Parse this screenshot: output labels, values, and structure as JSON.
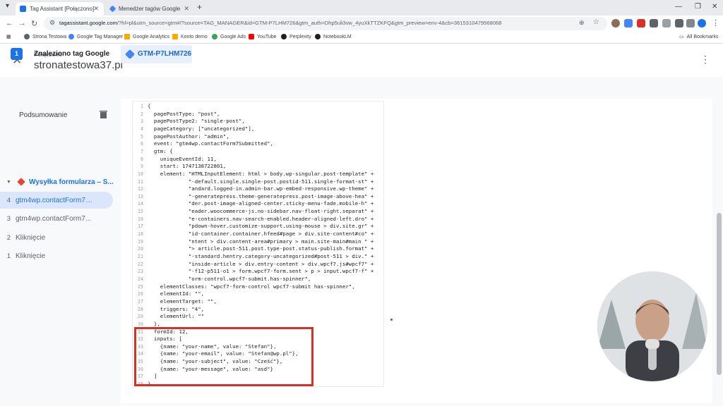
{
  "browser": {
    "tabs": [
      {
        "title": "Tag Assistant [Połączono]",
        "active": true
      },
      {
        "title": "Menedżer tagów Google",
        "active": false
      }
    ],
    "new_tab_glyph": "+",
    "url_host": "tagassistant.google.com",
    "url_rest": "/?hl=pl&utm_source=gtm#/?source=TAG_MANAGER&id=GTM-P7LHM726&gtm_auth=Dhp5uli3vw_4yuXkTTZKFQ&gtm_preview=env-4&cb=3615310479568068",
    "bookmarks": [
      {
        "label": "Strona Testowa",
        "color": "#5f6368"
      },
      {
        "label": "Google Tag Manager",
        "color": "#4285f4"
      },
      {
        "label": "Google Analytics",
        "color": "#f9ab00"
      },
      {
        "label": "Konto demo",
        "color": "#f9ab00"
      },
      {
        "label": "Google Ads",
        "color": "#34a853"
      },
      {
        "label": "YouTube",
        "color": "#ff0000"
      },
      {
        "label": "Perplexity",
        "color": "#202124"
      },
      {
        "label": "NotebookLM",
        "color": "#202124"
      }
    ],
    "all_bookmarks": "All Bookmarks"
  },
  "header": {
    "status": "Połączono",
    "site": "stronatestowa37.pl"
  },
  "subheader": {
    "step_number": "1",
    "found_label": "Znaleziono tag Google",
    "container_id": "GTM-P7LHM726"
  },
  "sidebar": {
    "summary_label": "Podsumowanie",
    "group_label": "Wysyłka formularza – S...",
    "items": [
      {
        "num": "4",
        "label": "gtm4wp.contactForm7S...",
        "selected": true
      },
      {
        "num": "3",
        "label": "gtm4wp.contactForm7...",
        "selected": false
      },
      {
        "num": "2",
        "label": "Kliknięcie",
        "selected": false
      },
      {
        "num": "1",
        "label": "Kliknięcie",
        "selected": false
      }
    ]
  },
  "code_lines": [
    {
      "n": "1",
      "t": "{"
    },
    {
      "n": "2",
      "t": "  pagePostType: \"post\","
    },
    {
      "n": "3",
      "t": "  pagePostType2: \"single-post\","
    },
    {
      "n": "4",
      "t": "  pageCategory: [\"uncategorized\"],"
    },
    {
      "n": "5",
      "t": "  pagePostAuthor: \"admin\","
    },
    {
      "n": "6",
      "t": "  event: \"gtm4wp.contactForm7Submitted\","
    },
    {
      "n": "7",
      "t": "  gtm: {"
    },
    {
      "n": "8",
      "t": "    uniqueEventId: 11,"
    },
    {
      "n": "9",
      "t": "    start: 1747138722801,"
    },
    {
      "n": "10",
      "t": "    element: \"HTMLInputElement: html > body.wp-singular.post-template\" +"
    },
    {
      "n": "11",
      "t": "             \"-default.single.single-post.postid-511.single-format-st\" +"
    },
    {
      "n": "12",
      "t": "             \"andard.logged-in.admin-bar.wp-embed-responsive.wp-theme\" +"
    },
    {
      "n": "13",
      "t": "             \"-generatepress.theme-generatepress.post-image-above-hea\" +"
    },
    {
      "n": "14",
      "t": "             \"der.post-image-aligned-center.sticky-menu-fade.mobile-h\" +"
    },
    {
      "n": "15",
      "t": "             \"eader.woocommerce-js.no-sidebar.nav-float-right.separat\" +"
    },
    {
      "n": "16",
      "t": "             \"e-containers.nav-search-enabled.header-aligned-left.dro\" +"
    },
    {
      "n": "17",
      "t": "             \"pdown-hover.customize-support.using-mouse > div.site.gr\" +"
    },
    {
      "n": "18",
      "t": "             \"id-container.container.hfeed#page > div.site-content#co\" +"
    },
    {
      "n": "19",
      "t": "             \"ntent > div.content-area#primary > main.site-main#main \" +"
    },
    {
      "n": "20",
      "t": "             \"> article.post-511.post.type-post.status-publish.format\" +"
    },
    {
      "n": "21",
      "t": "             \"-standard.hentry.category-uncategorized#post-511 > div.\" +"
    },
    {
      "n": "22",
      "t": "             \"inside-article > div.entry-content > div.wpcf7.js#wpcf7\" +"
    },
    {
      "n": "23",
      "t": "             \"-f12-p511-o1 > form.wpcf7-form.sent > p > input.wpcf7-f\" +"
    },
    {
      "n": "24",
      "t": "             \"orm-control.wpcf7-submit.has-spinner\","
    },
    {
      "n": "25",
      "t": "    elementClasses: \"wpcf7-form-control wpcf7-submit has-spinner\","
    },
    {
      "n": "26",
      "t": "    elementId: \"\","
    },
    {
      "n": "27",
      "t": "    elementTarget: \"\","
    },
    {
      "n": "28",
      "t": "    triggers: \"4\","
    },
    {
      "n": "29",
      "t": "    elementUrl: \"\""
    },
    {
      "n": "30",
      "t": "  },"
    },
    {
      "n": "31",
      "t": "  formId: 12,"
    },
    {
      "n": "32",
      "t": "  inputs: ["
    },
    {
      "n": "33",
      "t": "    {name: \"your-name\", value: \"Stefan\"},"
    },
    {
      "n": "34",
      "t": "    {name: \"your-email\", value: \"Stefan@wp.pl\"},"
    },
    {
      "n": "35",
      "t": "    {name: \"your-subject\", value: \"Cześć\"},"
    },
    {
      "n": "36",
      "t": "    {name: \"your-message\", value: \"asd\"}"
    },
    {
      "n": "37",
      "t": "  ]"
    },
    {
      "n": "38",
      "t": "}"
    }
  ],
  "colors": {
    "accent": "#1a73e8",
    "highlight_box": "#d93025",
    "selected_row": "#dbe6fb"
  },
  "icons": [
    "close-icon",
    "kebab-menu-icon",
    "trash-icon",
    "tag-diamond-icon",
    "apps-icon",
    "back-icon",
    "forward-icon",
    "reload-icon"
  ]
}
